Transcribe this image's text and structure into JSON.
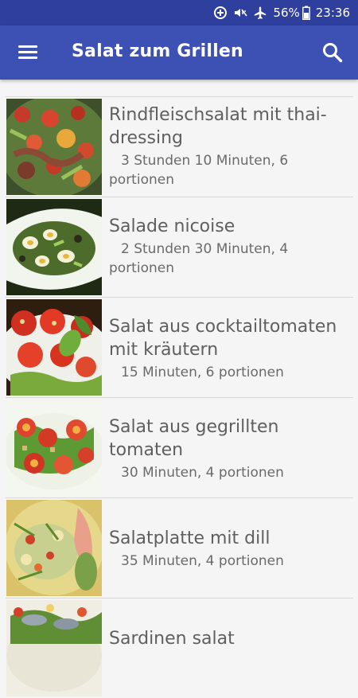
{
  "status_bar": {
    "battery_percent": "56%",
    "time": "23:36",
    "icons": [
      "data-saver-icon",
      "mute-vibrate-icon",
      "airplane-icon",
      "battery-icon"
    ]
  },
  "app_bar": {
    "title": "Salat zum Grillen",
    "menu_icon": "hamburger-menu-icon",
    "search_icon": "search-icon"
  },
  "recipes": [
    {
      "name": "Rindfleischsalat mit thai-dressing",
      "meta": "3 Stunden 10 Minuten, 6 portionen",
      "thumb": "beef-salad"
    },
    {
      "name": "Salade nicoise",
      "meta": "2 Stunden 30 Minuten, 4 portionen",
      "thumb": "nicoise"
    },
    {
      "name": "Salat aus cocktailtomaten mit kräutern",
      "meta": "15 Minuten, 6 portionen",
      "thumb": "tomato-herb"
    },
    {
      "name": "Salat aus gegrillten tomaten",
      "meta": "30 Minuten, 4 portionen",
      "thumb": "grilled-tomato"
    },
    {
      "name": "Salatplatte mit dill",
      "meta": "35 Minuten, 4 portionen",
      "thumb": "dill-plate"
    },
    {
      "name": "Sardinen salat",
      "meta": "",
      "thumb": "sardine"
    }
  ]
}
